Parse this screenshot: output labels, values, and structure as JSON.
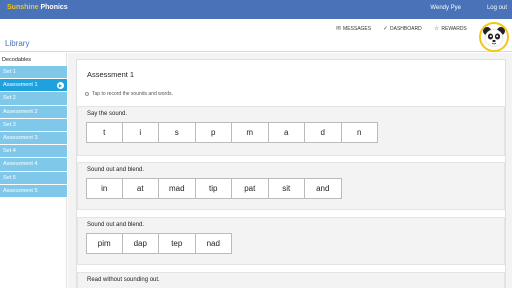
{
  "header": {
    "logo_part1": "Sunshine",
    "logo_part2": "Phonics",
    "user_name": "Wendy Pye",
    "logout": "Log out"
  },
  "subbar": {
    "library": "Library",
    "nav": [
      {
        "label": "MESSAGES",
        "icon": "mail-icon"
      },
      {
        "label": "DASHBOARD",
        "icon": "check-icon"
      },
      {
        "label": "REWARDS",
        "icon": "star-icon"
      }
    ]
  },
  "sidebar": {
    "heading": "Decodables",
    "items": [
      {
        "label": "Set 1",
        "active": false
      },
      {
        "label": "Assessment 1",
        "active": true
      },
      {
        "label": "Set 2",
        "active": false
      },
      {
        "label": "Assessment 2",
        "active": false
      },
      {
        "label": "Set 3",
        "active": false
      },
      {
        "label": "Assessment 3",
        "active": false
      },
      {
        "label": "Set 4",
        "active": false
      },
      {
        "label": "Assessment 4",
        "active": false
      },
      {
        "label": "Set 5",
        "active": false
      },
      {
        "label": "Assessment 5",
        "active": false
      }
    ]
  },
  "assessment": {
    "title": "Assessment 1",
    "instruction": "Tap to record the sounds and words.",
    "sections": [
      {
        "label": "Say the sound.",
        "tiles": [
          "t",
          "i",
          "s",
          "p",
          "m",
          "a",
          "d",
          "n"
        ]
      },
      {
        "label": "Sound out and blend.",
        "tiles": [
          "in",
          "at",
          "mad",
          "tip",
          "pat",
          "sit",
          "and"
        ]
      },
      {
        "label": "Sound out and blend.",
        "tiles": [
          "pim",
          "dap",
          "tep",
          "nad"
        ]
      },
      {
        "label": "Read without sounding out.",
        "tiles": []
      }
    ]
  },
  "colors": {
    "brand_blue": "#4a72b9",
    "sidebar_item": "#7fc8ea",
    "sidebar_active": "#1fa1de",
    "logo_yellow": "#f5c518"
  }
}
